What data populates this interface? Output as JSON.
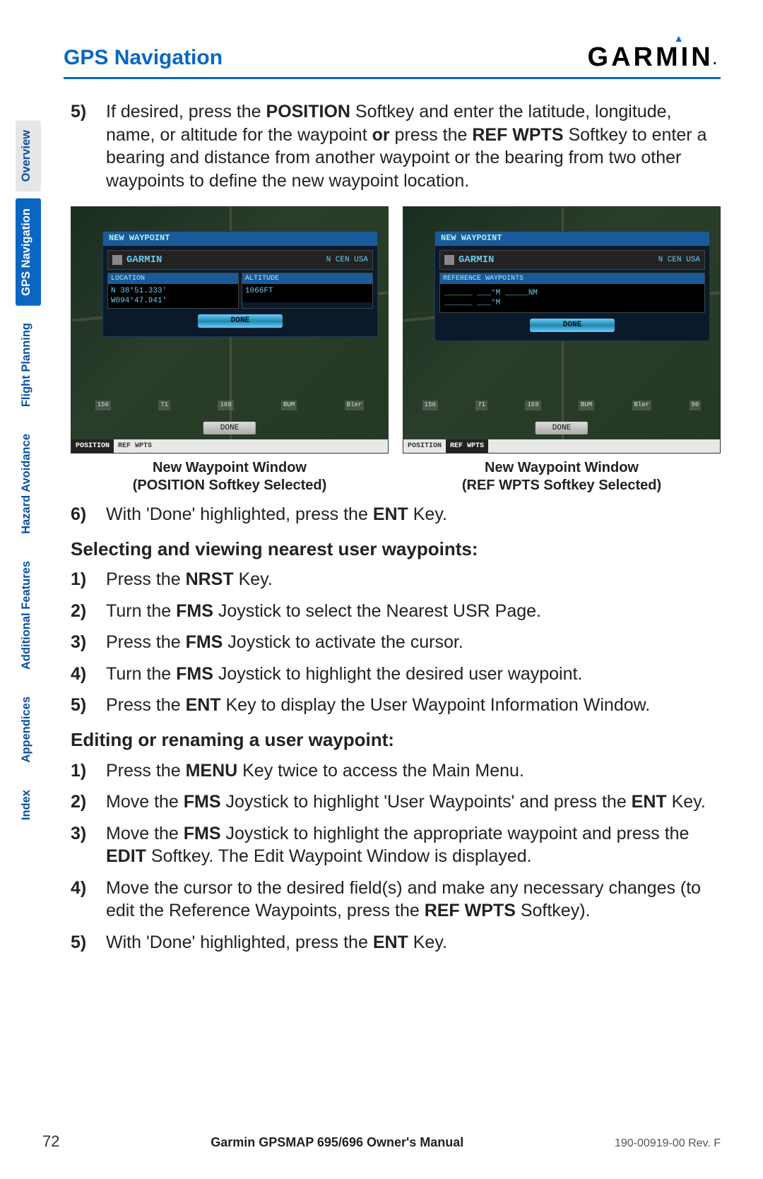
{
  "header": {
    "section_title": "GPS Navigation",
    "logo_text": "GARMIN",
    "logo_triangle": "▲"
  },
  "sidebar": [
    {
      "label": "Overview",
      "variant": "gray"
    },
    {
      "label": "GPS Navigation",
      "variant": "active"
    },
    {
      "label": "Flight Planning",
      "variant": "blue"
    },
    {
      "label": "Hazard Avoidance",
      "variant": "blue"
    },
    {
      "label": "Additional Features",
      "variant": "blue"
    },
    {
      "label": "Appendices",
      "variant": "blue"
    },
    {
      "label": "Index",
      "variant": "blue"
    }
  ],
  "steps5": {
    "num": "5)",
    "parts": [
      "If desired, press the ",
      "POSITION",
      " Softkey and enter the latitude, longitude, name, or altitude for the waypoint ",
      "or",
      " press the ",
      "REF WPTS",
      " Softkey to enter a bearing and distance from another waypoint or the bearing from two other waypoints to define the new waypoint location."
    ]
  },
  "figures": {
    "left": {
      "dialog_title": "NEW WAYPOINT",
      "name": "GARMIN",
      "region": "N CEN USA",
      "loc_label": "LOCATION",
      "loc_val": "N  38°51.333'\nW094°47.941'",
      "alt_label": "ALTITUDE",
      "alt_val": "1066FT",
      "done": "DONE",
      "bottom_done": "DONE",
      "softkey_active": "POSITION",
      "softkey_inactive": "REF WPTS",
      "markers": [
        "156",
        "71",
        "169",
        "BUM",
        "Bler"
      ],
      "caption_l1": "New Waypoint Window",
      "caption_l2": "(POSITION Softkey Selected)"
    },
    "right": {
      "dialog_title": "NEW WAYPOINT",
      "name": "GARMIN",
      "region": "N CEN USA",
      "ref_label": "REFERENCE WAYPOINTS",
      "ref_vals": "______   ___°M   _____NM\n______   ___°M",
      "done": "DONE",
      "bottom_done": "DONE",
      "softkey_inactive": "POSITION",
      "softkey_active": "REF WPTS",
      "markers": [
        "156",
        "71",
        "169",
        "BUM",
        "Bler",
        "50"
      ],
      "caption_l1": "New Waypoint Window",
      "caption_l2": "(REF WPTS Softkey Selected)"
    }
  },
  "step6": {
    "num": "6)",
    "parts": [
      "With 'Done' highlighted, press the ",
      "ENT",
      " Key."
    ]
  },
  "heading_a": "Selecting and viewing nearest user waypoints:",
  "listA": [
    {
      "num": "1)",
      "parts": [
        "Press the ",
        "NRST",
        " Key."
      ]
    },
    {
      "num": "2)",
      "parts": [
        "Turn the ",
        "FMS",
        " Joystick to select the Nearest USR Page."
      ]
    },
    {
      "num": "3)",
      "parts": [
        "Press the ",
        "FMS",
        " Joystick to activate the cursor."
      ]
    },
    {
      "num": "4)",
      "parts": [
        "Turn the ",
        "FMS",
        " Joystick to highlight the desired user waypoint."
      ]
    },
    {
      "num": "5)",
      "parts": [
        "Press the ",
        "ENT",
        " Key to display the User Waypoint Information Window."
      ]
    }
  ],
  "heading_b": "Editing or renaming a user waypoint:",
  "listB": [
    {
      "num": "1)",
      "parts": [
        "Press the ",
        "MENU",
        " Key twice to access the Main Menu."
      ]
    },
    {
      "num": "2)",
      "parts": [
        "Move the ",
        "FMS",
        " Joystick to highlight 'User Waypoints' and press the ",
        "ENT",
        " Key."
      ]
    },
    {
      "num": "3)",
      "parts": [
        "Move the ",
        "FMS",
        " Joystick to highlight the appropriate waypoint and press the ",
        "EDIT",
        " Softkey.  The Edit Waypoint Window is displayed."
      ]
    },
    {
      "num": "4)",
      "parts": [
        "Move the cursor to the desired field(s) and make any necessary changes (to edit the Reference Waypoints, press the ",
        "REF WPTS",
        " Softkey)."
      ]
    },
    {
      "num": "5)",
      "parts": [
        "With 'Done' highlighted, press the ",
        "ENT",
        " Key."
      ]
    }
  ],
  "footer": {
    "page": "72",
    "title": "Garmin GPSMAP 695/696 Owner's Manual",
    "rev": "190-00919-00  Rev. F"
  }
}
